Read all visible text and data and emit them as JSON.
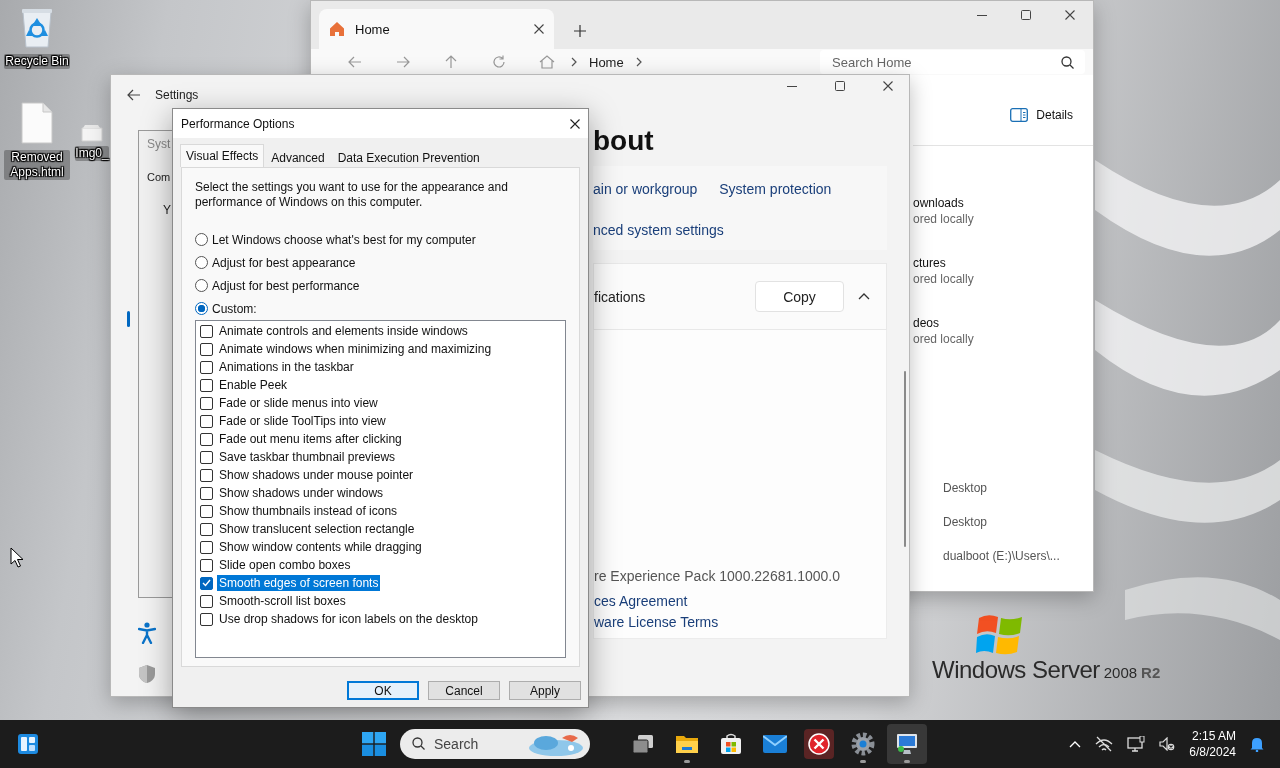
{
  "desktop": {
    "icons": [
      {
        "label": "Recycle Bin",
        "kind": "recycle-bin"
      },
      {
        "label": "Removed Apps.html",
        "kind": "document"
      },
      {
        "label": "Img0_",
        "kind": "image"
      }
    ],
    "brand": {
      "name": "Windows Server",
      "version": "2008",
      "edition": "R2"
    }
  },
  "explorer": {
    "tab": {
      "label": "Home"
    },
    "breadcrumb": [
      "Home"
    ],
    "search": {
      "placeholder": "Search Home"
    },
    "details_button": "Details",
    "folders": [
      {
        "name": "ownloads",
        "status": "ored locally"
      },
      {
        "name": "ctures",
        "status": "ored locally"
      },
      {
        "name": "deos",
        "status": "ored locally"
      }
    ],
    "column_3": [
      "Desktop",
      "Desktop",
      "dualboot (E:)\\Users\\..."
    ]
  },
  "settings": {
    "title": "Settings",
    "heading": "bout",
    "link_rows": [
      {
        "links": [
          "ain or workgroup",
          "System protection"
        ]
      },
      {
        "links": [
          "nced system settings"
        ]
      }
    ],
    "specifications": {
      "title": "fications",
      "copy_button": "Copy",
      "expanded": true,
      "version": "re Experience Pack 1000.22681.1000.0",
      "links": [
        "ces Agreement",
        "ware License Terms"
      ]
    }
  },
  "system_properties": {
    "title": "Syst",
    "tab": "Com",
    "text": "Y"
  },
  "performance_options": {
    "title": "Performance Options",
    "tabs": [
      {
        "label": "Visual Effects",
        "selected": true
      },
      {
        "label": "Advanced",
        "selected": false
      },
      {
        "label": "Data Execution Prevention",
        "selected": false
      }
    ],
    "intro": "Select the settings you want to use for the appearance and performance of Windows on this computer.",
    "options": [
      {
        "label": "Let Windows choose what's best for my computer",
        "selected": false
      },
      {
        "label": "Adjust for best appearance",
        "selected": false
      },
      {
        "label": "Adjust for best performance",
        "selected": false
      },
      {
        "label": "Custom:",
        "selected": true
      }
    ],
    "effects": [
      {
        "label": "Animate controls and elements inside windows",
        "checked": false,
        "selected": false
      },
      {
        "label": "Animate windows when minimizing and maximizing",
        "checked": false,
        "selected": false
      },
      {
        "label": "Animations in the taskbar",
        "checked": false,
        "selected": false
      },
      {
        "label": "Enable Peek",
        "checked": false,
        "selected": false
      },
      {
        "label": "Fade or slide menus into view",
        "checked": false,
        "selected": false
      },
      {
        "label": "Fade or slide ToolTips into view",
        "checked": false,
        "selected": false
      },
      {
        "label": "Fade out menu items after clicking",
        "checked": false,
        "selected": false
      },
      {
        "label": "Save taskbar thumbnail previews",
        "checked": false,
        "selected": false
      },
      {
        "label": "Show shadows under mouse pointer",
        "checked": false,
        "selected": false
      },
      {
        "label": "Show shadows under windows",
        "checked": false,
        "selected": false
      },
      {
        "label": "Show thumbnails instead of icons",
        "checked": false,
        "selected": false
      },
      {
        "label": "Show translucent selection rectangle",
        "checked": false,
        "selected": false
      },
      {
        "label": "Show window contents while dragging",
        "checked": false,
        "selected": false
      },
      {
        "label": "Slide open combo boxes",
        "checked": false,
        "selected": false
      },
      {
        "label": "Smooth edges of screen fonts",
        "checked": true,
        "selected": true
      },
      {
        "label": "Smooth-scroll list boxes",
        "checked": false,
        "selected": false
      },
      {
        "label": "Use drop shadows for icon labels on the desktop",
        "checked": false,
        "selected": false
      }
    ],
    "buttons": [
      {
        "label": "OK",
        "default": true
      },
      {
        "label": "Cancel",
        "default": false
      },
      {
        "label": "Apply",
        "default": false
      }
    ]
  },
  "taskbar": {
    "search": {
      "placeholder": "Search"
    },
    "apps": [
      {
        "kind": "task-view",
        "running": false,
        "active": false
      },
      {
        "kind": "file-explorer",
        "running": true,
        "active": false
      },
      {
        "kind": "store",
        "running": false,
        "active": false
      },
      {
        "kind": "mail",
        "running": false,
        "active": false
      },
      {
        "kind": "error",
        "running": false,
        "active": false
      },
      {
        "kind": "settings",
        "running": true,
        "active": false
      },
      {
        "kind": "remote-desktop",
        "running": true,
        "active": true
      }
    ],
    "clock": {
      "time": "2:15 AM",
      "date": "6/8/2024"
    }
  }
}
